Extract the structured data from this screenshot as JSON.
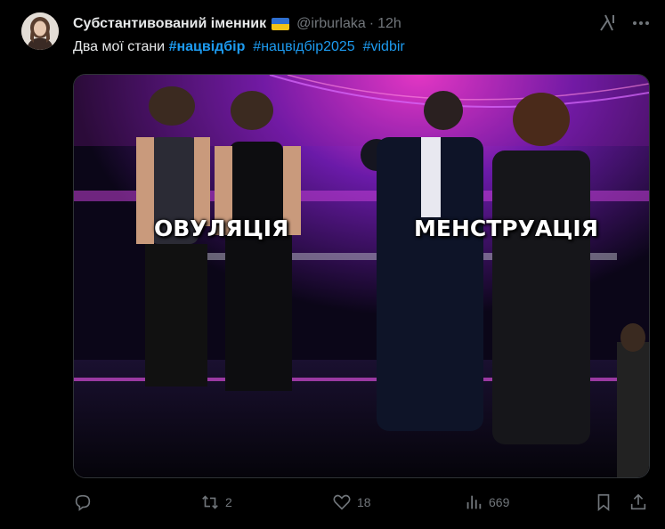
{
  "tweet": {
    "author_name": "Субстантивований іменник",
    "flag_icon": "ukraine-flag-icon",
    "handle": "@irburlaka",
    "separator": "·",
    "time": "12h",
    "text_prefix": "Два мої стани",
    "hashtags": [
      "#нацвідбір",
      "#нацвідбір2025",
      "#vidbir"
    ]
  },
  "media": {
    "caption_left": "ОВУЛЯЦІЯ",
    "caption_right": "МЕНСТРУАЦІЯ"
  },
  "actions": {
    "reply_count": "",
    "retweet_count": "2",
    "like_count": "18",
    "views_count": "669"
  },
  "colors": {
    "background": "#000000",
    "text": "#e7e9ea",
    "muted": "#71767b",
    "link": "#1d9bf0"
  }
}
